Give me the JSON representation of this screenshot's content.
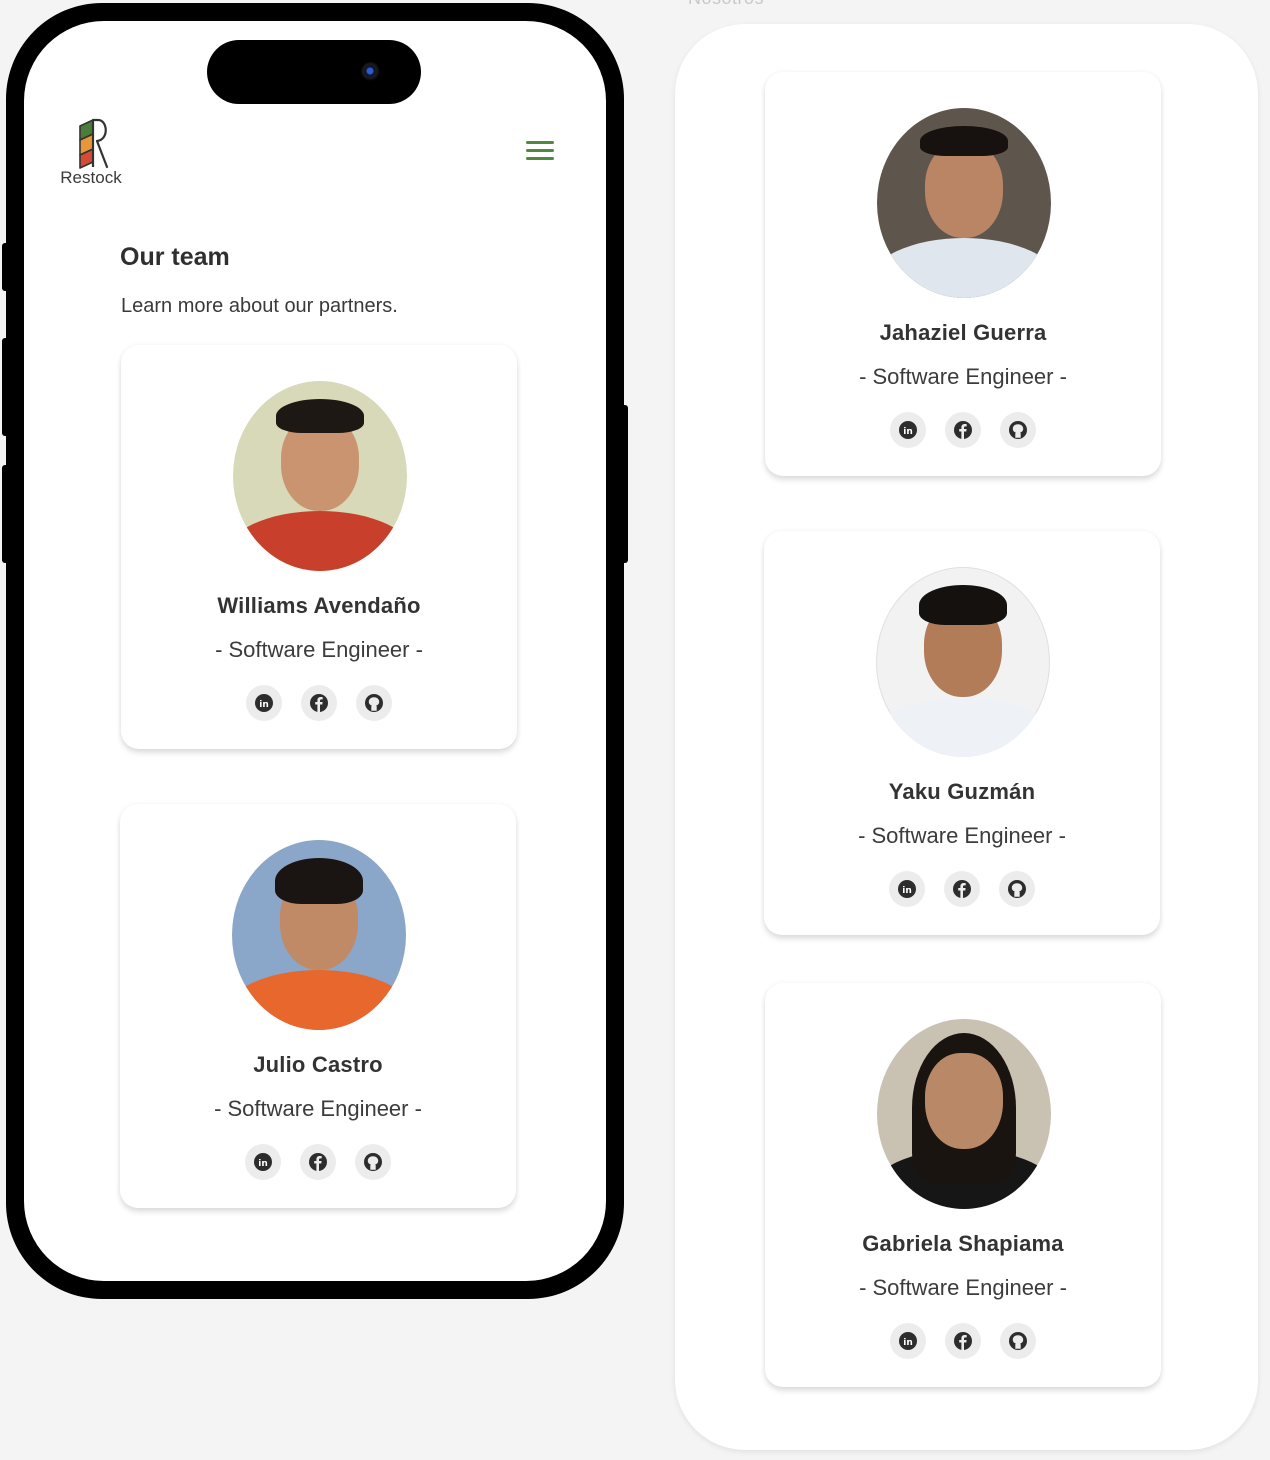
{
  "frame_label": "Nosotros",
  "app": {
    "name": "Restock",
    "brand_colors": {
      "accent": "#4f8a3f",
      "logo_green": "#4a7d3a",
      "logo_red": "#d34c35",
      "logo_orange": "#e8963a"
    }
  },
  "header": {
    "logo_label": "Restock",
    "menu_icon": "hamburger-icon"
  },
  "section": {
    "title": "Our team",
    "subtitle": "Learn more about our partners."
  },
  "members": [
    {
      "name": "Williams Avendaño",
      "role": "- Software Engineer -"
    },
    {
      "name": "Julio Castro",
      "role": "- Software Engineer -"
    },
    {
      "name": "Jahaziel Guerra",
      "role": "- Software Engineer -"
    },
    {
      "name": "Yaku Guzmán",
      "role": "- Software Engineer -"
    },
    {
      "name": "Gabriela Shapiama",
      "role": "- Software Engineer -"
    }
  ],
  "social_icons": [
    "linkedin-icon",
    "facebook-icon",
    "github-icon"
  ]
}
